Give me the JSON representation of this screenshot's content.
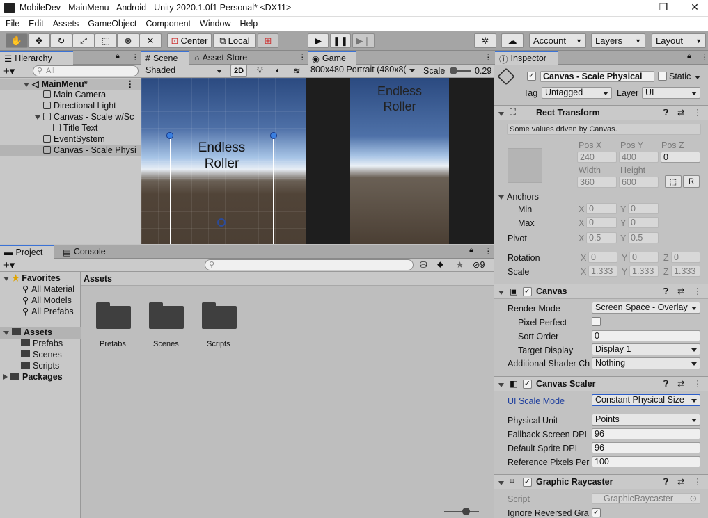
{
  "window": {
    "title": "MobileDev - MainMenu - Android - Unity 2020.1.0f1 Personal* <DX11>",
    "minimize": "–",
    "maximize": "❐",
    "close": "✕"
  },
  "menu": [
    "File",
    "Edit",
    "Assets",
    "GameObject",
    "Component",
    "Window",
    "Help"
  ],
  "toolbar": {
    "center": "Center",
    "local": "Local",
    "account": "Account",
    "layers": "Layers",
    "layout": "Layout"
  },
  "hierarchy": {
    "tab": "Hierarchy",
    "search": "All",
    "scene": "MainMenu*",
    "items": [
      "Main Camera",
      "Directional Light",
      "Canvas - Scale w/Sc",
      "Title Text",
      "EventSystem",
      "Canvas - Scale Physi"
    ]
  },
  "scene": {
    "tab": "Scene",
    "tab2": "Asset Store",
    "shading": "Shaded",
    "mode2d": "2D",
    "text1": "Endless",
    "text2": "Roller"
  },
  "game": {
    "tab": "Game",
    "resolution": "800x480 Portrait (480x8(",
    "scale_label": "Scale",
    "scale_val": "0.29",
    "text1": "Endless",
    "text2": "Roller"
  },
  "project": {
    "tab": "Project",
    "tab2": "Console",
    "favorites": "Favorites",
    "fav_items": [
      "All Material",
      "All Models",
      "All Prefabs"
    ],
    "assets": "Assets",
    "asset_items": [
      "Prefabs",
      "Scenes",
      "Scripts"
    ],
    "packages": "Packages",
    "breadcrumb": "Assets",
    "folders": [
      "Prefabs",
      "Scenes",
      "Scripts"
    ],
    "hidden_count": "9"
  },
  "inspector": {
    "tab": "Inspector",
    "name": "Canvas - Scale Physical",
    "static": "Static",
    "tag_label": "Tag",
    "tag": "Untagged",
    "layer_label": "Layer",
    "layer": "UI",
    "rect": {
      "title": "Rect Transform",
      "note": "Some values driven by Canvas.",
      "posx_l": "Pos X",
      "posy_l": "Pos Y",
      "posz_l": "Pos Z",
      "posx": "240",
      "posy": "400",
      "posz": "0",
      "width_l": "Width",
      "height_l": "Height",
      "width": "360",
      "height": "600",
      "r": "R",
      "anchors": "Anchors",
      "min": "Min",
      "max": "Max",
      "x": "X",
      "y": "Y",
      "z": "Z",
      "minx": "0",
      "miny": "0",
      "maxx": "0",
      "maxy": "0",
      "pivot": "Pivot",
      "pivx": "0.5",
      "pivy": "0.5",
      "rotation": "Rotation",
      "rotx": "0",
      "roty": "0",
      "rotz": "0",
      "scale": "Scale",
      "sx": "1.333",
      "sy": "1.333",
      "sz": "1.333"
    },
    "canvas": {
      "title": "Canvas",
      "render_mode_l": "Render Mode",
      "render_mode": "Screen Space - Overlay",
      "pixel_perfect": "Pixel Perfect",
      "sort_order_l": "Sort Order",
      "sort_order": "0",
      "target_display_l": "Target Display",
      "target_display": "Display 1",
      "shader_l": "Additional Shader Ch",
      "shader": "Nothing"
    },
    "scaler": {
      "title": "Canvas Scaler",
      "mode_l": "UI Scale Mode",
      "mode": "Constant Physical Size",
      "unit_l": "Physical Unit",
      "unit": "Points",
      "fallback_l": "Fallback Screen DPI",
      "fallback": "96",
      "sprite_l": "Default Sprite DPI",
      "sprite": "96",
      "ref_l": "Reference Pixels Per",
      "ref": "100"
    },
    "raycaster": {
      "title": "Graphic Raycaster",
      "script_l": "Script",
      "script": "GraphicRaycaster",
      "ignore_l": "Ignore Reversed Gra"
    }
  },
  "colors": {
    "accent": "#3a72d6",
    "skyTop": "#2e4e86",
    "ground": "#514438"
  }
}
